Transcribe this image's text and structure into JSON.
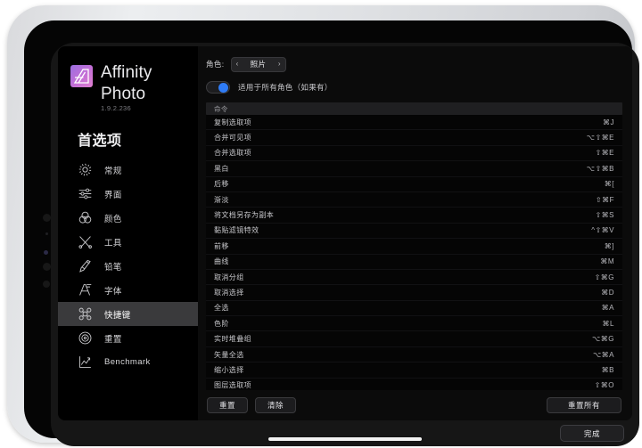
{
  "app": {
    "name": "Affinity Photo",
    "version": "1.9.2.236",
    "logo_icon": "affinity-photo-logo"
  },
  "sidebar": {
    "heading": "首选项",
    "items": [
      {
        "label": "常规",
        "icon": "gear-icon",
        "selected": false
      },
      {
        "label": "界面",
        "icon": "sliders-icon",
        "selected": false
      },
      {
        "label": "颜色",
        "icon": "color-circles-icon",
        "selected": false
      },
      {
        "label": "工具",
        "icon": "tools-icon",
        "selected": false
      },
      {
        "label": "铅笔",
        "icon": "pencil-icon",
        "selected": false
      },
      {
        "label": "字体",
        "icon": "font-icon",
        "selected": false
      },
      {
        "label": "快捷键",
        "icon": "command-icon",
        "selected": true
      },
      {
        "label": "重置",
        "icon": "reset-icon",
        "selected": false
      },
      {
        "label": "Benchmark",
        "icon": "chart-icon",
        "selected": false
      }
    ]
  },
  "panel": {
    "role_label": "角色:",
    "role_value": "照片",
    "prev_arrow": "‹",
    "next_arrow": "›",
    "toggle_label": "适用于所有角色（如果有）",
    "toggle_on": true,
    "toggle_accent": "#2f7cf6",
    "list_header": "命令",
    "commands": [
      {
        "name": "复制选取项",
        "key": "⌘J"
      },
      {
        "name": "合并可见项",
        "key": "⌥⇧⌘E"
      },
      {
        "name": "合并选取项",
        "key": "⇧⌘E"
      },
      {
        "name": "黑白",
        "key": "⌥⇧⌘B"
      },
      {
        "name": "后移",
        "key": "⌘["
      },
      {
        "name": "渐淡",
        "key": "⇧⌘F"
      },
      {
        "name": "将文档另存为副本",
        "key": "⇧⌘S"
      },
      {
        "name": "黏贴滤镜特效",
        "key": "^⇧⌘V"
      },
      {
        "name": "前移",
        "key": "⌘]"
      },
      {
        "name": "曲线",
        "key": "⌘M"
      },
      {
        "name": "取消分组",
        "key": "⇧⌘G"
      },
      {
        "name": "取消选择",
        "key": "⌘D"
      },
      {
        "name": "全选",
        "key": "⌘A"
      },
      {
        "name": "色阶",
        "key": "⌘L"
      },
      {
        "name": "实时堆叠组",
        "key": "⌥⌘G"
      },
      {
        "name": "矢量全选",
        "key": "⌥⌘A"
      },
      {
        "name": "缩小选择",
        "key": "⌘B"
      },
      {
        "name": "图层选取项",
        "key": "⇧⌘O"
      }
    ],
    "buttons": {
      "reset": "重置",
      "clear": "清除",
      "reset_all": "重置所有"
    }
  },
  "bottom": {
    "done": "完成"
  }
}
